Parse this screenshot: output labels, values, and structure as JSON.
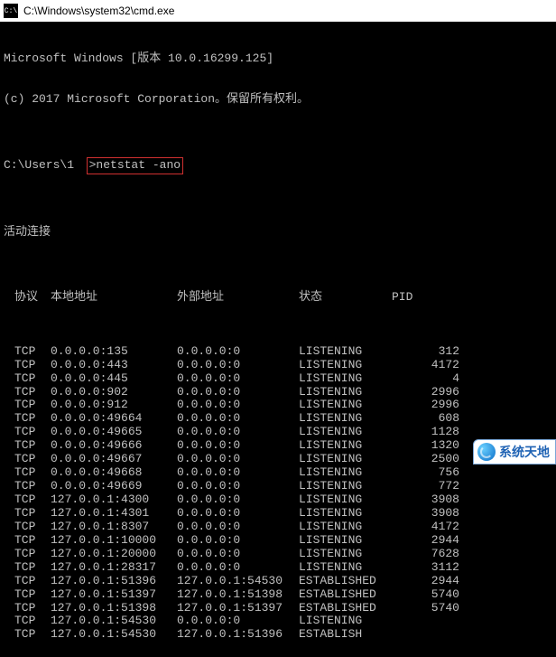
{
  "window": {
    "title": "C:\\Windows\\system32\\cmd.exe",
    "icon_label": "C:\\"
  },
  "banner": {
    "line1": "Microsoft Windows [版本 10.0.16299.125]",
    "line2": "(c) 2017 Microsoft Corporation。保留所有权利。"
  },
  "prompt": {
    "path": "C:\\Users\\1",
    "caret_cmd": ">netstat -ano"
  },
  "section_title": "活动连接",
  "headers": {
    "proto": "协议",
    "local": "本地地址",
    "foreign": "外部地址",
    "state": "状态",
    "pid": "PID"
  },
  "rows": [
    {
      "proto": "TCP",
      "local": "0.0.0.0:135",
      "foreign": "0.0.0.0:0",
      "state": "LISTENING",
      "pid": "312"
    },
    {
      "proto": "TCP",
      "local": "0.0.0.0:443",
      "foreign": "0.0.0.0:0",
      "state": "LISTENING",
      "pid": "4172"
    },
    {
      "proto": "TCP",
      "local": "0.0.0.0:445",
      "foreign": "0.0.0.0:0",
      "state": "LISTENING",
      "pid": "4"
    },
    {
      "proto": "TCP",
      "local": "0.0.0.0:902",
      "foreign": "0.0.0.0:0",
      "state": "LISTENING",
      "pid": "2996"
    },
    {
      "proto": "TCP",
      "local": "0.0.0.0:912",
      "foreign": "0.0.0.0:0",
      "state": "LISTENING",
      "pid": "2996"
    },
    {
      "proto": "TCP",
      "local": "0.0.0.0:49664",
      "foreign": "0.0.0.0:0",
      "state": "LISTENING",
      "pid": "608"
    },
    {
      "proto": "TCP",
      "local": "0.0.0.0:49665",
      "foreign": "0.0.0.0:0",
      "state": "LISTENING",
      "pid": "1128"
    },
    {
      "proto": "TCP",
      "local": "0.0.0.0:49666",
      "foreign": "0.0.0.0:0",
      "state": "LISTENING",
      "pid": "1320"
    },
    {
      "proto": "TCP",
      "local": "0.0.0.0:49667",
      "foreign": "0.0.0.0:0",
      "state": "LISTENING",
      "pid": "2500"
    },
    {
      "proto": "TCP",
      "local": "0.0.0.0:49668",
      "foreign": "0.0.0.0:0",
      "state": "LISTENING",
      "pid": "756"
    },
    {
      "proto": "TCP",
      "local": "0.0.0.0:49669",
      "foreign": "0.0.0.0:0",
      "state": "LISTENING",
      "pid": "772"
    },
    {
      "proto": "TCP",
      "local": "127.0.0.1:4300",
      "foreign": "0.0.0.0:0",
      "state": "LISTENING",
      "pid": "3908"
    },
    {
      "proto": "TCP",
      "local": "127.0.0.1:4301",
      "foreign": "0.0.0.0:0",
      "state": "LISTENING",
      "pid": "3908"
    },
    {
      "proto": "TCP",
      "local": "127.0.0.1:8307",
      "foreign": "0.0.0.0:0",
      "state": "LISTENING",
      "pid": "4172"
    },
    {
      "proto": "TCP",
      "local": "127.0.0.1:10000",
      "foreign": "0.0.0.0:0",
      "state": "LISTENING",
      "pid": "2944"
    },
    {
      "proto": "TCP",
      "local": "127.0.0.1:20000",
      "foreign": "0.0.0.0:0",
      "state": "LISTENING",
      "pid": "7628"
    },
    {
      "proto": "TCP",
      "local": "127.0.0.1:28317",
      "foreign": "0.0.0.0:0",
      "state": "LISTENING",
      "pid": "3112"
    },
    {
      "proto": "TCP",
      "local": "127.0.0.1:51396",
      "foreign": "127.0.0.1:54530",
      "state": "ESTABLISHED",
      "pid": "2944"
    },
    {
      "proto": "TCP",
      "local": "127.0.0.1:51397",
      "foreign": "127.0.0.1:51398",
      "state": "ESTABLISHED",
      "pid": "5740"
    },
    {
      "proto": "TCP",
      "local": "127.0.0.1:51398",
      "foreign": "127.0.0.1:51397",
      "state": "ESTABLISHED",
      "pid": "5740"
    },
    {
      "proto": "TCP",
      "local": "127.0.0.1:54530",
      "foreign": "0.0.0.0:0",
      "state": "LISTENING",
      "pid": ""
    },
    {
      "proto": "TCP",
      "local": "127.0.0.1:54530",
      "foreign": "127.0.0.1:51396",
      "state": "ESTABLISH",
      "pid": ""
    }
  ],
  "watermark": {
    "text": "系统天地"
  }
}
